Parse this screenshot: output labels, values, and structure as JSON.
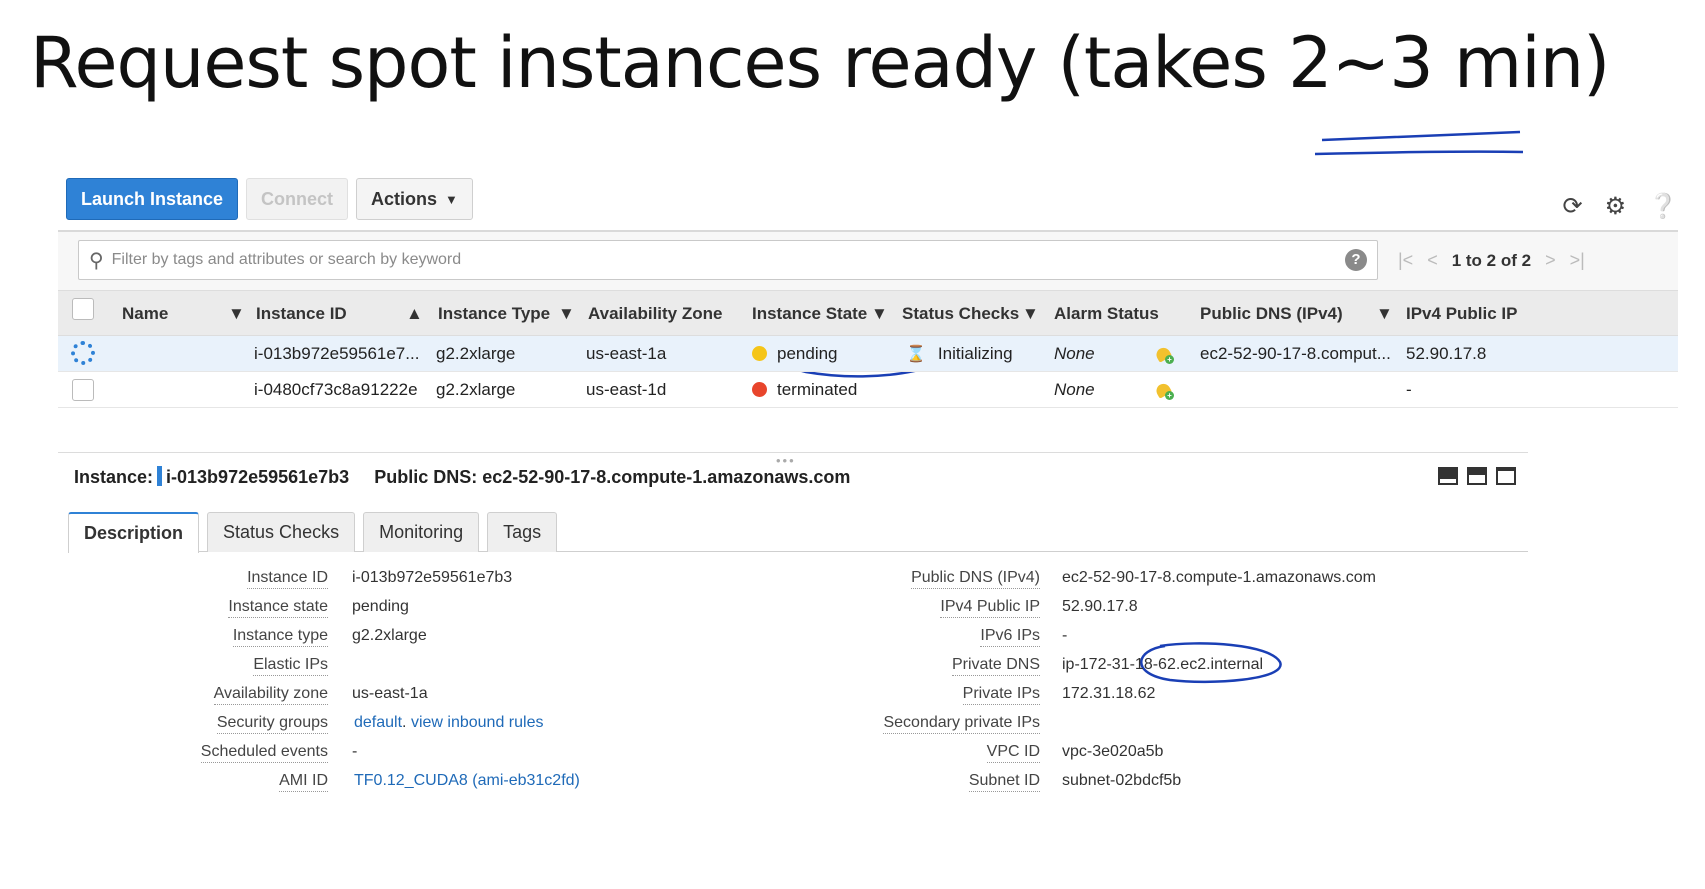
{
  "slide_title": "Request spot instances ready (takes 2~3 min)",
  "annotation_color": "#1a3fb5",
  "toolbar": {
    "launch_label": "Launch Instance",
    "connect_label": "Connect",
    "actions_label": "Actions"
  },
  "search": {
    "placeholder": "Filter by tags and attributes or search by keyword"
  },
  "pager": {
    "text": "1 to 2 of 2"
  },
  "table": {
    "headers": [
      "Name",
      "Instance ID",
      "Instance Type",
      "Availability Zone",
      "Instance State",
      "Status Checks",
      "Alarm Status",
      "Public DNS (IPv4)",
      "IPv4 Public IP"
    ],
    "rows": [
      {
        "instance_id": "i-013b972e59561e7...",
        "type": "g2.2xlarge",
        "zone": "us-east-1a",
        "state": "pending",
        "state_color": "#f5c518",
        "status_checks": "Initializing",
        "alarm": "None",
        "dns": "ec2-52-90-17-8.comput...",
        "ip": "52.90.17.8"
      },
      {
        "instance_id": "i-0480cf73c8a91222e",
        "type": "g2.2xlarge",
        "zone": "us-east-1d",
        "state": "terminated",
        "state_color": "#e8452c",
        "status_checks": "",
        "alarm": "None",
        "dns": "",
        "ip": "-"
      }
    ]
  },
  "detail": {
    "instance_label": "Instance:",
    "instance_id": "i-013b972e59561e7b3",
    "public_dns_label": "Public DNS: ec2-52-90-17-8.compute-1.amazonaws.com",
    "tabs": [
      "Description",
      "Status Checks",
      "Monitoring",
      "Tags"
    ],
    "left": [
      {
        "k": "Instance ID",
        "v": "i-013b972e59561e7b3"
      },
      {
        "k": "Instance state",
        "v": "pending"
      },
      {
        "k": "Instance type",
        "v": "g2.2xlarge"
      },
      {
        "k": "Elastic IPs",
        "v": ""
      },
      {
        "k": "Availability zone",
        "v": "us-east-1a"
      },
      {
        "k": "Security groups",
        "v": ""
      },
      {
        "k": "Scheduled events",
        "v": "-"
      },
      {
        "k": "AMI ID",
        "v": "TF0.12_CUDA8 (ami-eb31c2fd)"
      }
    ],
    "security_links": [
      "default",
      "view inbound rules"
    ],
    "right": [
      {
        "k": "Public DNS (IPv4)",
        "v": "ec2-52-90-17-8.compute-1.amazonaws.com"
      },
      {
        "k": "IPv4 Public IP",
        "v": "52.90.17.8"
      },
      {
        "k": "IPv6 IPs",
        "v": "-"
      },
      {
        "k": "Private DNS",
        "v": "ip-172-31-18-62.ec2.internal"
      },
      {
        "k": "Private IPs",
        "v": "172.31.18.62"
      },
      {
        "k": "Secondary private IPs",
        "v": ""
      },
      {
        "k": "VPC ID",
        "v": "vpc-3e020a5b"
      },
      {
        "k": "Subnet ID",
        "v": "subnet-02bdcf5b"
      }
    ]
  }
}
